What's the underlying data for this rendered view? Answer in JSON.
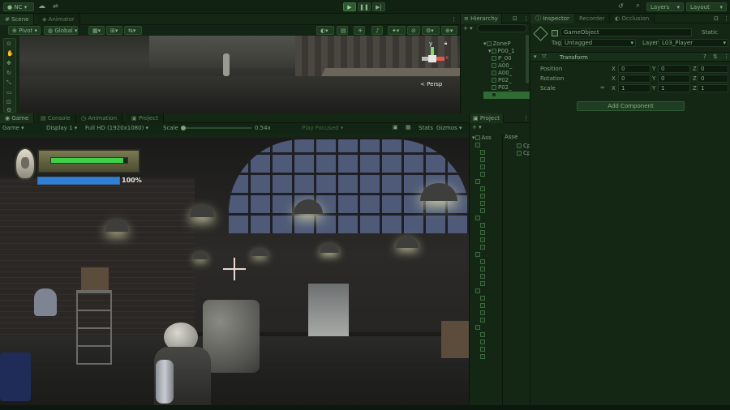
{
  "toolbar": {
    "account_label": "NC",
    "layers_label": "Layers",
    "layout_label": "Layout"
  },
  "scene_panel": {
    "tabs": [
      "Scene",
      "Animator"
    ],
    "pivot_label": "Pivot",
    "global_label": "Global",
    "persp_label": "Persp",
    "gizmo_axes": {
      "x": "x",
      "y": "y",
      "z": "z"
    }
  },
  "game_panel": {
    "tabs": [
      "Game",
      "Console",
      "Animation",
      "Project"
    ],
    "display_label": "Game",
    "display_select": "Display 1",
    "resolution_select": "Full HD (1920x1080)",
    "scale_label": "Scale",
    "scale_value": "0.54x",
    "play_focused_label": "Play Focused",
    "stats_label": "Stats",
    "gizmos_label": "Gizmos",
    "hud": {
      "energy_percent_label": "100%",
      "health_fill": 0.95,
      "energy_fill": 1.0
    }
  },
  "hierarchy_panel": {
    "title": "Hierarchy",
    "items": [
      "ZoneP",
      "P00_1",
      "P_00",
      "A00_",
      "A00_",
      "P02_",
      "P02_"
    ]
  },
  "project_panel": {
    "title": "Project",
    "assets_label": "Asse",
    "root_label": "Ass",
    "files": [
      "CpW",
      "CpW"
    ]
  },
  "inspector": {
    "tabs": [
      "Inspector",
      "Recorder",
      "Occlusion"
    ],
    "object_name": "GameObject",
    "static_label": "Static",
    "tag_label": "Tag",
    "tag_value": "Untagged",
    "layer_label": "Layer",
    "layer_value": "L03_Player",
    "component_title": "Transform",
    "position_label": "Position",
    "rotation_label": "Rotation",
    "scale_label": "Scale",
    "position": {
      "x": "0",
      "y": "0",
      "z": "0"
    },
    "rotation": {
      "x": "0",
      "y": "0",
      "z": "0"
    },
    "scale": {
      "x": "1",
      "y": "1",
      "z": "1"
    },
    "axis_x": "X",
    "axis_y": "Y",
    "axis_z": "Z",
    "add_component_label": "Add Component"
  },
  "colors": {
    "chrome": "#142715",
    "accent": "#2f6b33",
    "hud_green": "#3fd04a",
    "hud_blue": "#2f7fd8"
  }
}
